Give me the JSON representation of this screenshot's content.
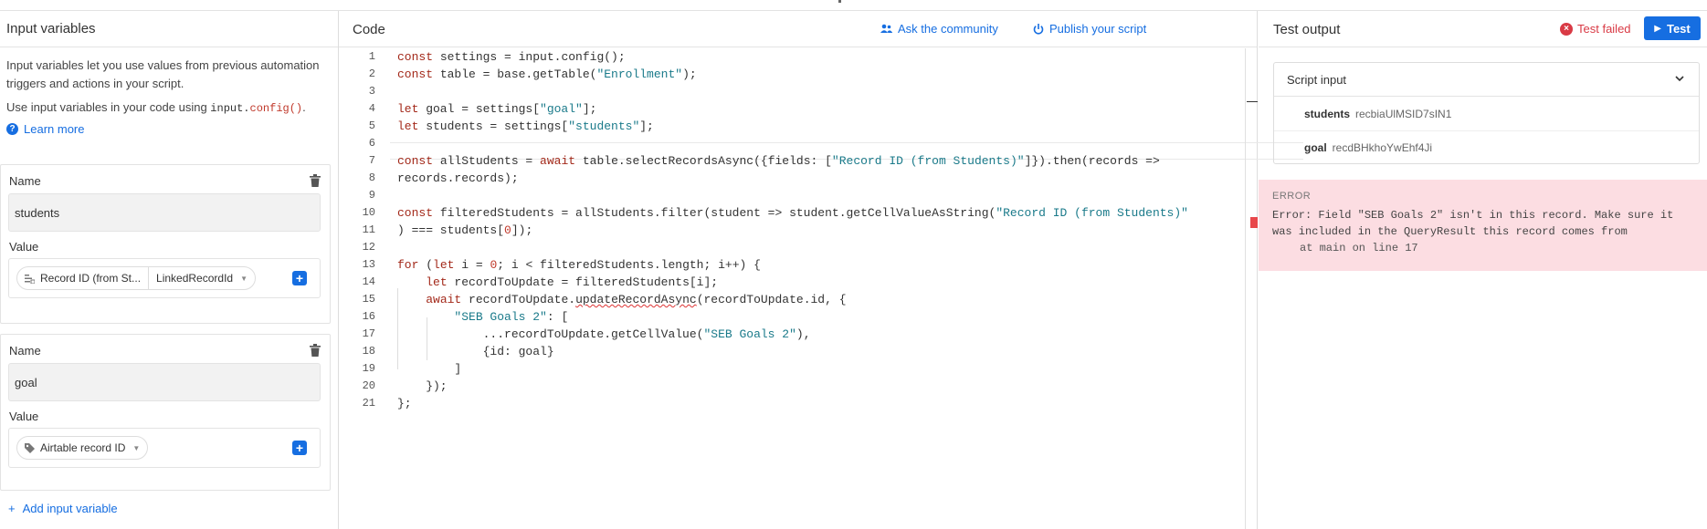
{
  "left": {
    "title": "Input variables",
    "description": "Input variables let you use values from previous automation triggers and actions in your script.",
    "usage_prefix": "Use input variables in your code using ",
    "usage_code_a": "input.",
    "usage_code_b": "config()",
    "usage_suffix": ".",
    "learn_more": "Learn more",
    "variables": [
      {
        "name_label": "Name",
        "name_value": "students",
        "value_label": "Value",
        "pill_main": "Record ID (from St...",
        "pill_secondary": "LinkedRecordId"
      },
      {
        "name_label": "Name",
        "name_value": "goal",
        "value_label": "Value",
        "pill_main": "Airtable record ID"
      }
    ],
    "add_label": "Add input variable"
  },
  "code": {
    "title": "Code",
    "ask_community": "Ask the community",
    "publish": "Publish your script",
    "lines": [
      "1",
      "2",
      "3",
      "4",
      "5",
      "6",
      "7",
      "8",
      "9",
      "10",
      "11",
      "12",
      "13",
      "14",
      "15",
      "16",
      "17",
      "18",
      "19",
      "20",
      "21"
    ]
  },
  "right": {
    "title": "Test output",
    "status": "Test failed",
    "test_button": "Test",
    "script_input_label": "Script input",
    "inputs": [
      {
        "key": "students",
        "value": "recbiaUlMSID7sIN1"
      },
      {
        "key": "goal",
        "value": "recdBHkhoYwEhf4Ji"
      }
    ],
    "error_title": "ERROR",
    "error_message": "Error: Field \"SEB Goals 2\" isn't in this record. Make sure it\nwas included in the QueryResult this record comes from",
    "error_at": "at main on line 17"
  },
  "colors": {
    "accent": "#166ee1",
    "error": "#d93a45",
    "error_bg": "#fcdde2"
  }
}
